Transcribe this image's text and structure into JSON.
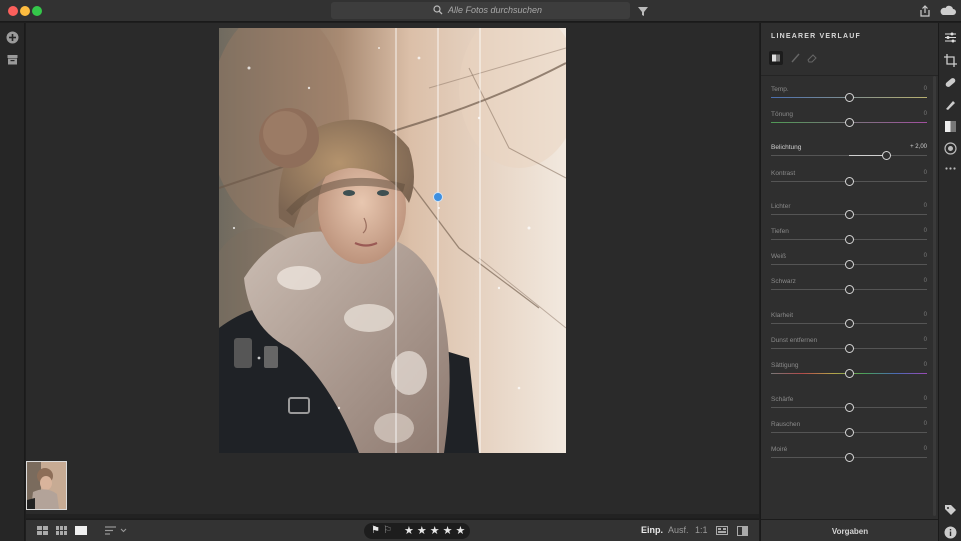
{
  "titlebar": {
    "search_placeholder": "Alle Fotos durchsuchen",
    "icons": [
      "close-dot",
      "minimize-dot",
      "zoom-dot",
      "search-icon",
      "filter-icon",
      "share-icon",
      "cloud-icon"
    ]
  },
  "leftstrip": {
    "icons": [
      "add-photos-icon",
      "library-icon"
    ]
  },
  "bottombar": {
    "view_icons": [
      "grid-square-icon",
      "grid-small-icon",
      "single-view-icon",
      "sort-icon"
    ],
    "rating_stars": "★★★★★",
    "view_modes": {
      "fit": "Einp.",
      "fill": "Ausf.",
      "one_to_one": "1:1"
    },
    "compare_icons": [
      "before-after-icon",
      "compare-icon"
    ]
  },
  "panel": {
    "title": "LINEARER VERLAUF",
    "mask_tools": [
      "linear-gradient-icon",
      "brush-icon",
      "eraser-icon"
    ],
    "sliders": [
      {
        "label": "Temp.",
        "value": "0",
        "level": 0.5,
        "active": false,
        "gradient": "temp"
      },
      {
        "label": "Tönung",
        "value": "0",
        "level": 0.5,
        "active": false,
        "gradient": "tint"
      },
      {
        "label": "Belichtung",
        "value": "+ 2,00",
        "level": 0.74,
        "active": true,
        "gradient": "none"
      },
      {
        "label": "Kontrast",
        "value": "0",
        "level": 0.5,
        "active": false,
        "gradient": "none"
      },
      {
        "label": "Lichter",
        "value": "0",
        "level": 0.5,
        "active": false,
        "gradient": "none"
      },
      {
        "label": "Tiefen",
        "value": "0",
        "level": 0.5,
        "active": false,
        "gradient": "none"
      },
      {
        "label": "Weiß",
        "value": "0",
        "level": 0.5,
        "active": false,
        "gradient": "none"
      },
      {
        "label": "Schwarz",
        "value": "0",
        "level": 0.5,
        "active": false,
        "gradient": "none"
      },
      {
        "label": "Klarheit",
        "value": "0",
        "level": 0.5,
        "active": false,
        "gradient": "none"
      },
      {
        "label": "Dunst entfernen",
        "value": "0",
        "level": 0.5,
        "active": false,
        "gradient": "none"
      },
      {
        "label": "Sättigung",
        "value": "0",
        "level": 0.5,
        "active": false,
        "gradient": "sat"
      },
      {
        "label": "Schärfe",
        "value": "0",
        "level": 0.5,
        "active": false,
        "gradient": "none"
      },
      {
        "label": "Rauschen",
        "value": "0",
        "level": 0.5,
        "active": false,
        "gradient": "none"
      },
      {
        "label": "Moiré",
        "value": "0",
        "level": 0.5,
        "active": false,
        "gradient": "none"
      }
    ],
    "presets_label": "Vorgaben"
  },
  "tools": {
    "icons": [
      "edit-sliders-icon",
      "crop-icon",
      "healing-icon",
      "brush-tool-icon",
      "linear-gradient-tool-icon",
      "radial-gradient-tool-icon",
      "more-icon",
      "tag-icon",
      "info-icon"
    ]
  },
  "colors": {
    "accent_blue": "#3d8fe0",
    "traffic_red": "#fc605c",
    "traffic_yellow": "#fdbc40",
    "traffic_green": "#34c84a"
  }
}
